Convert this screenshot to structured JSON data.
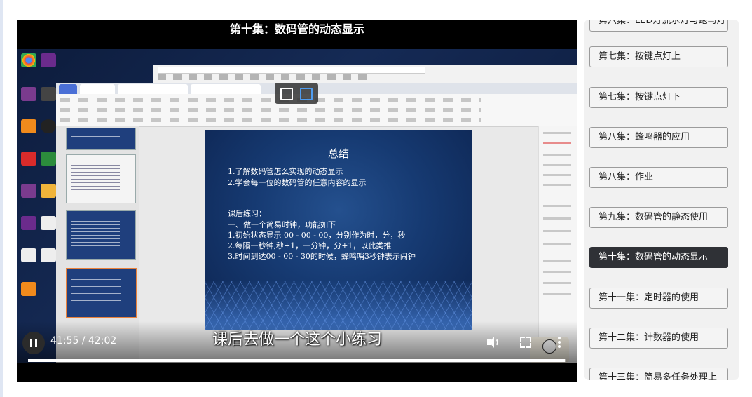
{
  "player": {
    "title": "第十集：数码管的动态显示",
    "subtitle": "课后去做一个这个小练习",
    "time": "41:55 / 42:02",
    "progress_fraction": 0.997,
    "controls": {
      "play_state": "playing",
      "volume_icon": "volume-icon",
      "fullscreen_icon": "fullscreen-icon",
      "more_icon": "more-options-icon"
    }
  },
  "slide": {
    "title": "总结",
    "lines": [
      "1.了解数码管怎么实现的动态显示",
      "2.学会每一位的数码管的任意内容的显示",
      "课后练习：",
      "一、做一个简易时钟，功能如下",
      "1.初始状态显示 00 - 00 - 00，分别作为时，分，秒",
      "2.每隔一秒钟,秒+1，一分钟，分+1，以此类推",
      "3.时间到达00 - 00 - 30的时候，蜂鸣哨3秒钟表示闹钟"
    ]
  },
  "playlist": {
    "items": [
      {
        "label": "第六集：LED灯流水灯与跑马灯",
        "active": false
      },
      {
        "label": "第七集：按键点灯上",
        "active": false
      },
      {
        "label": "第七集：按键点灯下",
        "active": false
      },
      {
        "label": "第八集：蜂鸣器的应用",
        "active": false
      },
      {
        "label": "第八集：作业",
        "active": false
      },
      {
        "label": "第九集：数码管的静态使用",
        "active": false
      },
      {
        "label": "第十集：数码管的动态显示",
        "active": true
      },
      {
        "label": "第十一集：定时器的使用",
        "active": false
      },
      {
        "label": "第十二集：计数器的使用",
        "active": false
      },
      {
        "label": "第十三集：简易多任务处理上",
        "active": false
      }
    ]
  },
  "colors": {
    "active_episode": "#2f3136",
    "player_bg": "#000000",
    "playlist_bg": "#f1f1f1"
  }
}
